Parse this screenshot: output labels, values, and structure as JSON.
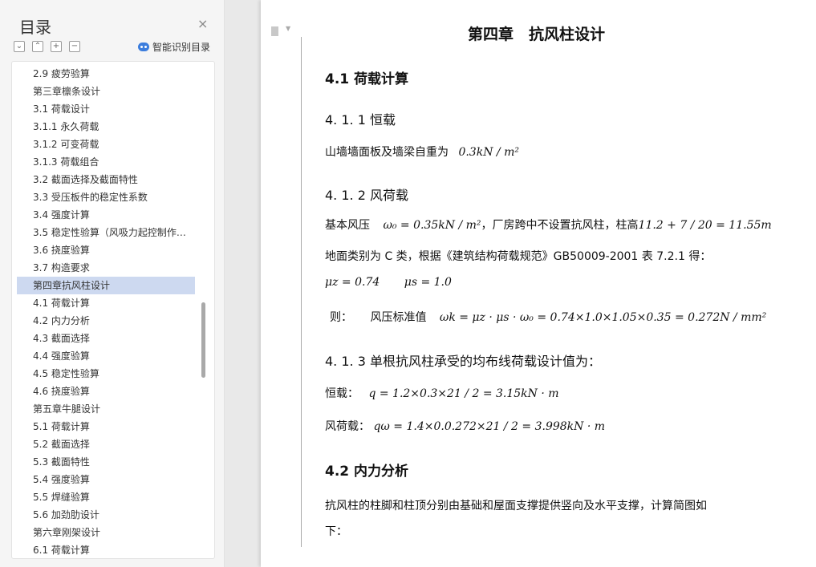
{
  "sidebar": {
    "title": "目录",
    "close_symbol": "×",
    "tools": [
      "⌄",
      "⌃",
      "+",
      "−"
    ],
    "ai_label": "智能识别目录",
    "items": [
      "2.9 疲劳验算",
      "第三章檩条设计",
      "3.1 荷载设计",
      "3.1.1 永久荷载",
      "3.1.2 可变荷载",
      "3.1.3 荷载组合",
      "3.2 截面选择及截面特性",
      "3.3 受压板件的稳定性系数",
      "3.4 强度计算",
      "3.5 稳定性验算（风吸力起控制作…",
      "3.6 挠度验算",
      "3.7 构造要求",
      "第四章抗风柱设计",
      "4.1 荷载计算",
      "4.2 内力分析",
      "4.3 截面选择",
      "4.4 强度验算",
      "4.5 稳定性验算",
      "4.6 挠度验算",
      "第五章牛腿设计",
      "5.1 荷载计算",
      "5.2 截面选择",
      "5.3 截面特性",
      "5.4 强度验算",
      "5.5 焊缝验算",
      "5.6 加劲肋设计",
      "第六章刚架设计",
      "6.1 荷载计算"
    ],
    "active_index": 12
  },
  "doc": {
    "chapter_title": "第四章　抗风柱设计",
    "s41": "4.1 荷载计算",
    "s411": "4. 1. 1 恒载",
    "p1_text": "山墙墙面板及墙梁自重为",
    "p1_math": "0.3kN / m²",
    "s412": "4. 1. 2 风荷载",
    "p2_text_a": "基本风压",
    "p2_math_a": "ω₀ = 0.35kN / m²",
    "p2_text_b": "，厂房跨中不设置抗风柱，柱高",
    "p2_math_b": "11.2 + 7 / 20 = 11.55m",
    "p3": "地面类别为 C 类，根据《建筑结构荷载规范》GB50009-2001 表 7.2.1 得：",
    "p4_math_a": "μz = 0.74",
    "p4_math_b": "μs = 1.0",
    "p5_text_a": "则：",
    "p5_text_b": "风压标准值",
    "p5_math": "ωk = μz · μs · ω₀ = 0.74×1.0×1.05×0.35 = 0.272N / mm²",
    "s413": "4. 1. 3 单根抗风柱承受的均布线荷载设计值为：",
    "p6_text": "恒载：",
    "p6_math": "q = 1.2×0.3×21 / 2 = 3.15kN · m",
    "p7_text": "风荷载：",
    "p7_math": "qω = 1.4×0.0.272×21 / 2 = 3.998kN · m",
    "s42": "4.2 内力分析",
    "p8_line1": "抗风柱的柱脚和柱顶分别由基础和屋面支撑提供竖向及水平支撑，计算简图如",
    "p8_line2": "下："
  }
}
